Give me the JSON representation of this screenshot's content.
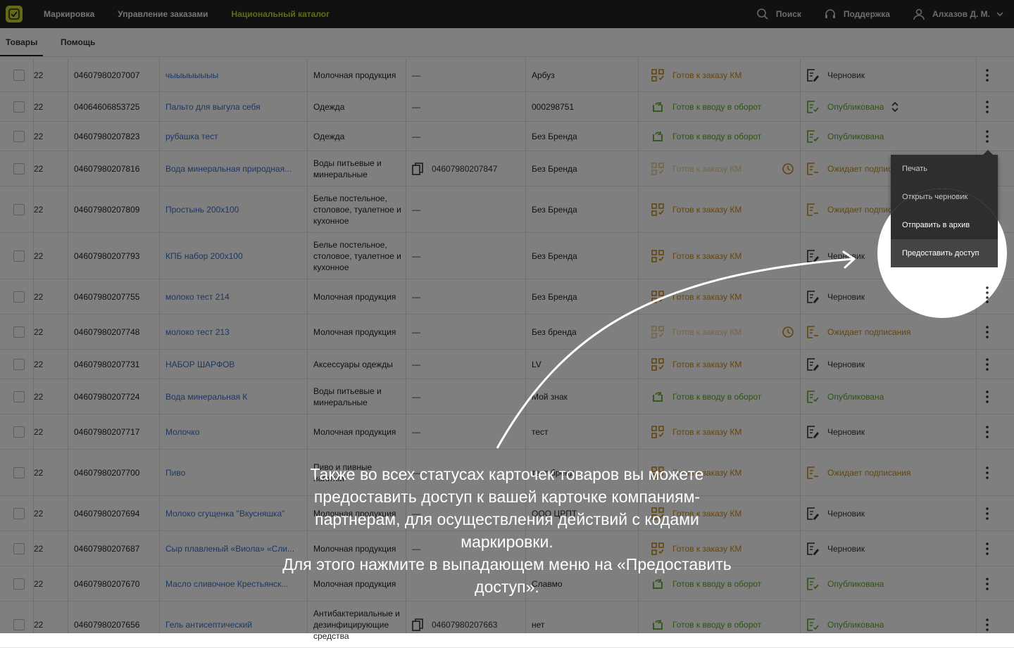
{
  "header": {
    "nav": [
      "Маркировка",
      "Управление заказами",
      "Национальный каталог"
    ],
    "search_label": "Поиск",
    "support_label": "Поддержка",
    "user_name": "Алхазов Д. М."
  },
  "tabs": [
    "Товары",
    "Помощь"
  ],
  "rows": [
    {
      "id": "22",
      "gtin": "04607980207007",
      "name": "чыыыыыыыы",
      "category": "Молочная продукция",
      "tnved": "—",
      "brand": "Арбуз",
      "status": "Готов к заказу КМ",
      "pub": "Черновик"
    },
    {
      "id": "22",
      "gtin": "04064606853725",
      "name": "Пальто для выгула себя",
      "category": "Одежда",
      "tnved": "—",
      "brand": "000298751",
      "status": "Готов к вводу в оборот",
      "pub": "Опубликована"
    },
    {
      "id": "22",
      "gtin": "04607980207823",
      "name": "рубашка тест",
      "category": "Одежда",
      "tnved": "—",
      "brand": "Без Бренда",
      "status": "Готов к вводу в оборот",
      "pub": "Опубликована"
    },
    {
      "id": "22",
      "gtin": "04607980207816",
      "name": "Вода минеральная природная...",
      "category": "Воды питьевые и минеральные",
      "tnved": "04607980207847",
      "brand": "Без Бренда",
      "status": "Готов к заказу КМ",
      "pub": "Ожидает подписания"
    },
    {
      "id": "22",
      "gtin": "04607980207809",
      "name": "Простынь 200х100",
      "category": "Белье постельное, столовое, туалетное и кухонное",
      "tnved": "—",
      "brand": "Без Бренда",
      "status": "Готов к заказу КМ",
      "pub": "Ожидает подписания"
    },
    {
      "id": "22",
      "gtin": "04607980207793",
      "name": "КПБ набор 200х100",
      "category": "Белье постельное, столовое, туалетное и кухонное",
      "tnved": "—",
      "brand": "Без Бренда",
      "status": "Готов к заказу КМ",
      "pub": "Черновик"
    },
    {
      "id": "22",
      "gtin": "04607980207755",
      "name": "молоко тест 214",
      "category": "Молочная продукция",
      "tnved": "—",
      "brand": "Без Бренда",
      "status": "Готов к заказу КМ",
      "pub": "Черновик"
    },
    {
      "id": "22",
      "gtin": "04607980207748",
      "name": "молоко тест 213",
      "category": "Молочная продукция",
      "tnved": "—",
      "brand": "Без бренда",
      "status": "Готов к заказу КМ",
      "pub": "Ожидает подписания"
    },
    {
      "id": "22",
      "gtin": "04607980207731",
      "name": "НАБОР ШАРФОВ",
      "category": "Аксессуары одежды",
      "tnved": "—",
      "brand": "LV",
      "status": "Готов к заказу КМ",
      "pub": "Черновик"
    },
    {
      "id": "22",
      "gtin": "04607980207724",
      "name": "Вода минеральная К",
      "category": "Воды питьевые и минеральные",
      "tnved": "—",
      "brand": "Мой знак",
      "status": "Готов к вводу в оборот",
      "pub": "Опубликована"
    },
    {
      "id": "22",
      "gtin": "04607980207717",
      "name": "Молочко",
      "category": "Молочная продукция",
      "tnved": "—",
      "brand": "тест",
      "status": "Готов к заказу КМ",
      "pub": "Черновик"
    },
    {
      "id": "22",
      "gtin": "04607980207700",
      "name": "Пиво",
      "category": "Пиво и пивные напитки",
      "tnved": "—",
      "brand": "тест бренд",
      "status": "Готов к заказу КМ",
      "pub": "Ожидает подписания"
    },
    {
      "id": "22",
      "gtin": "04607980207694",
      "name": "Молоко сгущенка \"Вкусняшка\"",
      "category": "Молочная продукция",
      "tnved": "—",
      "brand": "ООО ЦРПТ",
      "status": "Готов к заказу КМ",
      "pub": "Черновик"
    },
    {
      "id": "22",
      "gtin": "04607980207687",
      "name": "Сыр плавленый «Виола» «Сли...",
      "category": "Молочная продукция",
      "tnved": "—",
      "brand": "",
      "status": "Готов к заказу КМ",
      "pub": "Черновик"
    },
    {
      "id": "22",
      "gtin": "04607980207670",
      "name": "Масло сливочное Крестьянск...",
      "category": "Молочная продукция",
      "tnved": "",
      "brand": "Славмо",
      "status": "Готов к вводу в оборот",
      "pub": "Опубликована"
    },
    {
      "id": "22",
      "gtin": "04607980207656",
      "name": "Гель антисептический",
      "category": "Антибактериальные и дезинфицирующие средства",
      "tnved": "04607980207663",
      "brand": "нет",
      "status": "Готов к вводу в оборот",
      "pub": "Опубликована"
    }
  ],
  "menu": [
    "Печать",
    "Открыть черновик",
    "Отправить в архив",
    "Предоставить доступ"
  ],
  "caption": [
    "Также во всех статусах карточек товаров вы можете предоставить доступ к вашей карточке компаниям-партнерам, для осуществления действий с кодами маркировки.",
    "Для этого нажмите в выпадающем меню на «Предоставить доступ»."
  ]
}
